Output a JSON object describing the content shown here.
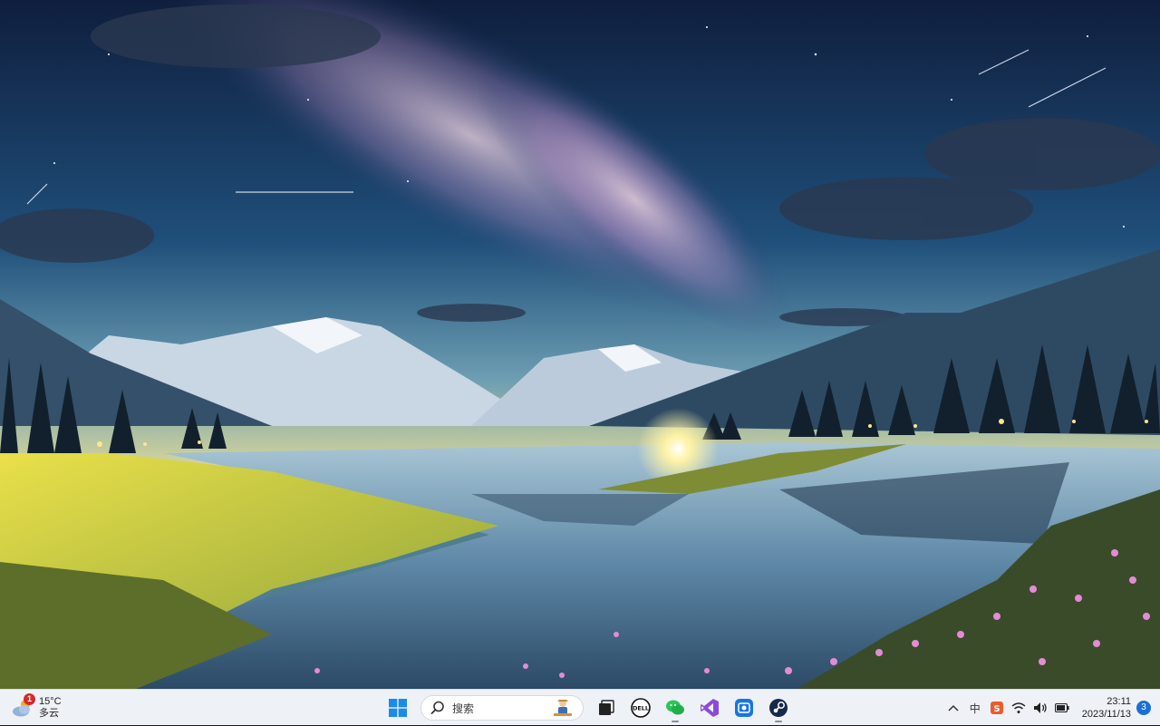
{
  "taskbar": {
    "weather": {
      "badge": "1",
      "temp": "15°C",
      "condition": "多云"
    },
    "search": {
      "placeholder": "搜索"
    },
    "apps": [
      {
        "name": "start-icon"
      },
      {
        "name": "search-box"
      },
      {
        "name": "task-view-icon"
      },
      {
        "name": "dell-icon"
      },
      {
        "name": "wechat-icon"
      },
      {
        "name": "visual-studio-icon"
      },
      {
        "name": "screen-capture-icon"
      },
      {
        "name": "steam-icon"
      }
    ],
    "tray": {
      "ime": "中",
      "clock_time": "23:11",
      "clock_date": "2023/11/13",
      "notifications": "3"
    }
  },
  "colors": {
    "taskbar_bg": "#eef1f6",
    "accent": "#1a6fd6",
    "badge": "#d42a2a"
  }
}
